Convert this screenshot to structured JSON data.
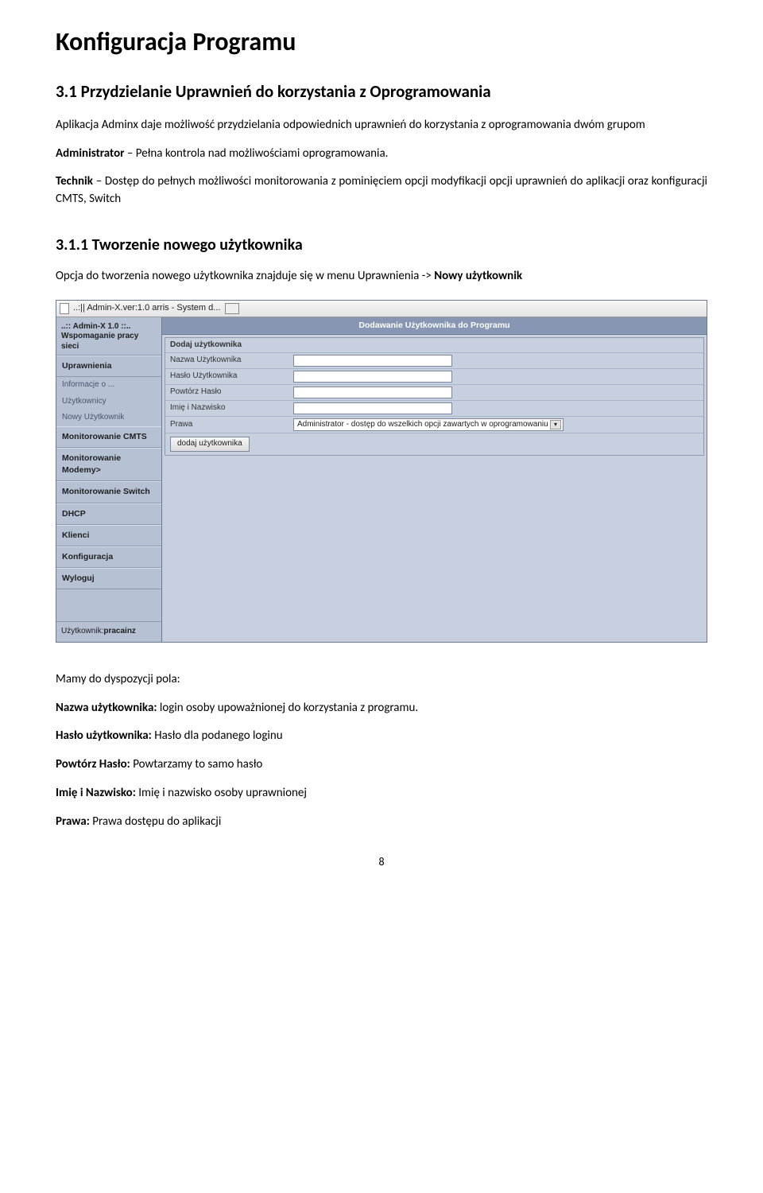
{
  "doc": {
    "title": "Konfiguracja Programu",
    "h2": "3.1 Przydzielanie Uprawnień do korzystania z Oprogramowania",
    "p1": "Aplikacja Adminx daje możliwość przydzielania odpowiednich uprawnień do korzystania z oprogramowania dwóm grupom",
    "p2a": "Administrator",
    "p2b": " – Pełna kontrola nad możliwościami oprogramowania.",
    "p3a": "Technik",
    "p3b": " – Dostęp do pełnych możliwości monitorowania z pominięciem opcji modyfikacji opcji uprawnień do aplikacji oraz konfiguracji CMTS, Switch",
    "h3": "3.1.1 Tworzenie nowego użytkownika",
    "p4a": "Opcja do tworzenia nowego użytkownika znajduje się w menu Uprawnienia -> ",
    "p4b": "Nowy użytkownik",
    "p5": "Mamy do dyspozycji pola:",
    "f1a": "Nazwa użytkownika:",
    "f1b": "  login osoby upoważnionej do korzystania z programu.",
    "f2a": "Hasło użytkownika:",
    "f2b": " Hasło dla podanego loginu",
    "f3a": "Powtórz Hasło:",
    "f3b": " Powtarzamy to samo hasło",
    "f4a": "Imię i Nazwisko:",
    "f4b": " Imię i nazwisko osoby uprawnionej",
    "f5a": "Prawa:",
    "f5b": "  Prawa dostępu do aplikacji",
    "pagenum": "8"
  },
  "app": {
    "window_title": "..:|| Admin-X.ver:1.0 arris - System d...",
    "brand_line1": "..:: Admin-X 1.0 ::..",
    "brand_line2": "Wspomaganie pracy sieci",
    "sidebar": {
      "uprawnienia": "Uprawnienia",
      "sub1": "Informacje o ...",
      "sub2": "Użytkownicy",
      "sub3": "Nowy Użytkownik",
      "m_cmts": "Monitorowanie CMTS",
      "m_modemy": "Monitorowanie Modemy>",
      "m_switch": "Monitorowanie Switch",
      "dhcp": "DHCP",
      "klienci": "Klienci",
      "konfig": "Konfiguracja",
      "wyloguj": "Wyloguj"
    },
    "footer_label": "Użytkownik:",
    "footer_user": "pracainz",
    "main_title": "Dodawanie Użytkownika do Programu",
    "form": {
      "row1": "Dodaj użytkownika",
      "row2": "Nazwa Użytkownika",
      "row3": "Hasło Użytkownika",
      "row4": "Powtórz Hasło",
      "row5": "Imię i Nazwisko",
      "row6": "Prawa",
      "select_text": "Administrator - dostęp do wszelkich opcji zawartych w oprogramowaniu",
      "button": "dodaj użytkownika"
    }
  }
}
